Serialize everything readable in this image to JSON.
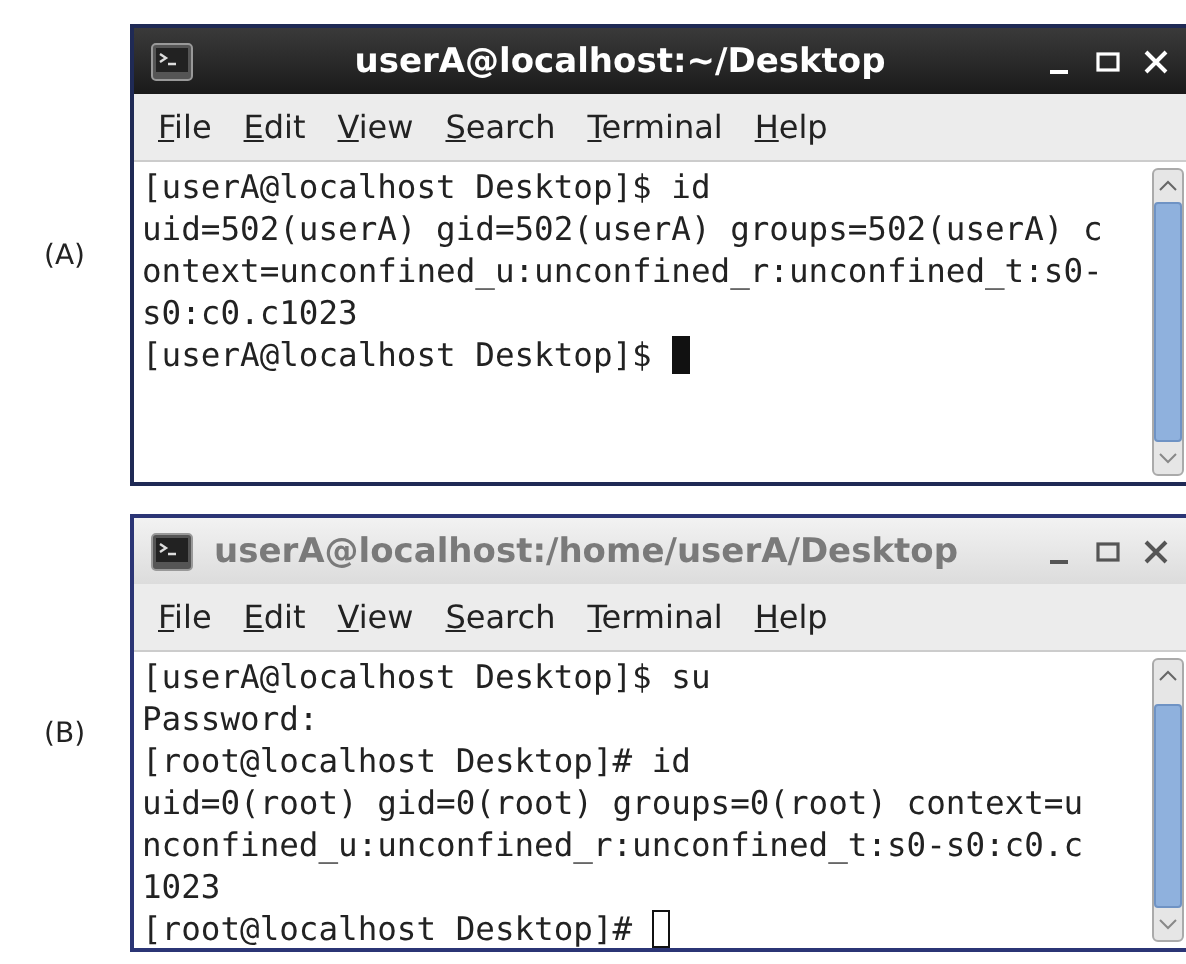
{
  "panels": [
    {
      "label": "(A)",
      "window": {
        "title": "userA@localhost:~/Desktop",
        "active": true,
        "menu": [
          "File",
          "Edit",
          "View",
          "Search",
          "Terminal",
          "Help"
        ],
        "lines": [
          "[userA@localhost Desktop]$ id",
          "uid=502(userA) gid=502(userA) groups=502(userA) c",
          "ontext=unconfined_u:unconfined_r:unconfined_t:s0-",
          "s0:c0.c1023"
        ],
        "prompt": "[userA@localhost Desktop]$ "
      }
    },
    {
      "label": "(B)",
      "window": {
        "title": "userA@localhost:/home/userA/Desktop",
        "active": false,
        "menu": [
          "File",
          "Edit",
          "View",
          "Search",
          "Terminal",
          "Help"
        ],
        "lines": [
          "[userA@localhost Desktop]$ su",
          "Password:",
          "[root@localhost Desktop]# id",
          "uid=0(root) gid=0(root) groups=0(root) context=u",
          "nconfined_u:unconfined_r:unconfined_t:s0-s0:c0.c",
          "1023"
        ],
        "prompt": "[root@localhost Desktop]# "
      }
    }
  ]
}
